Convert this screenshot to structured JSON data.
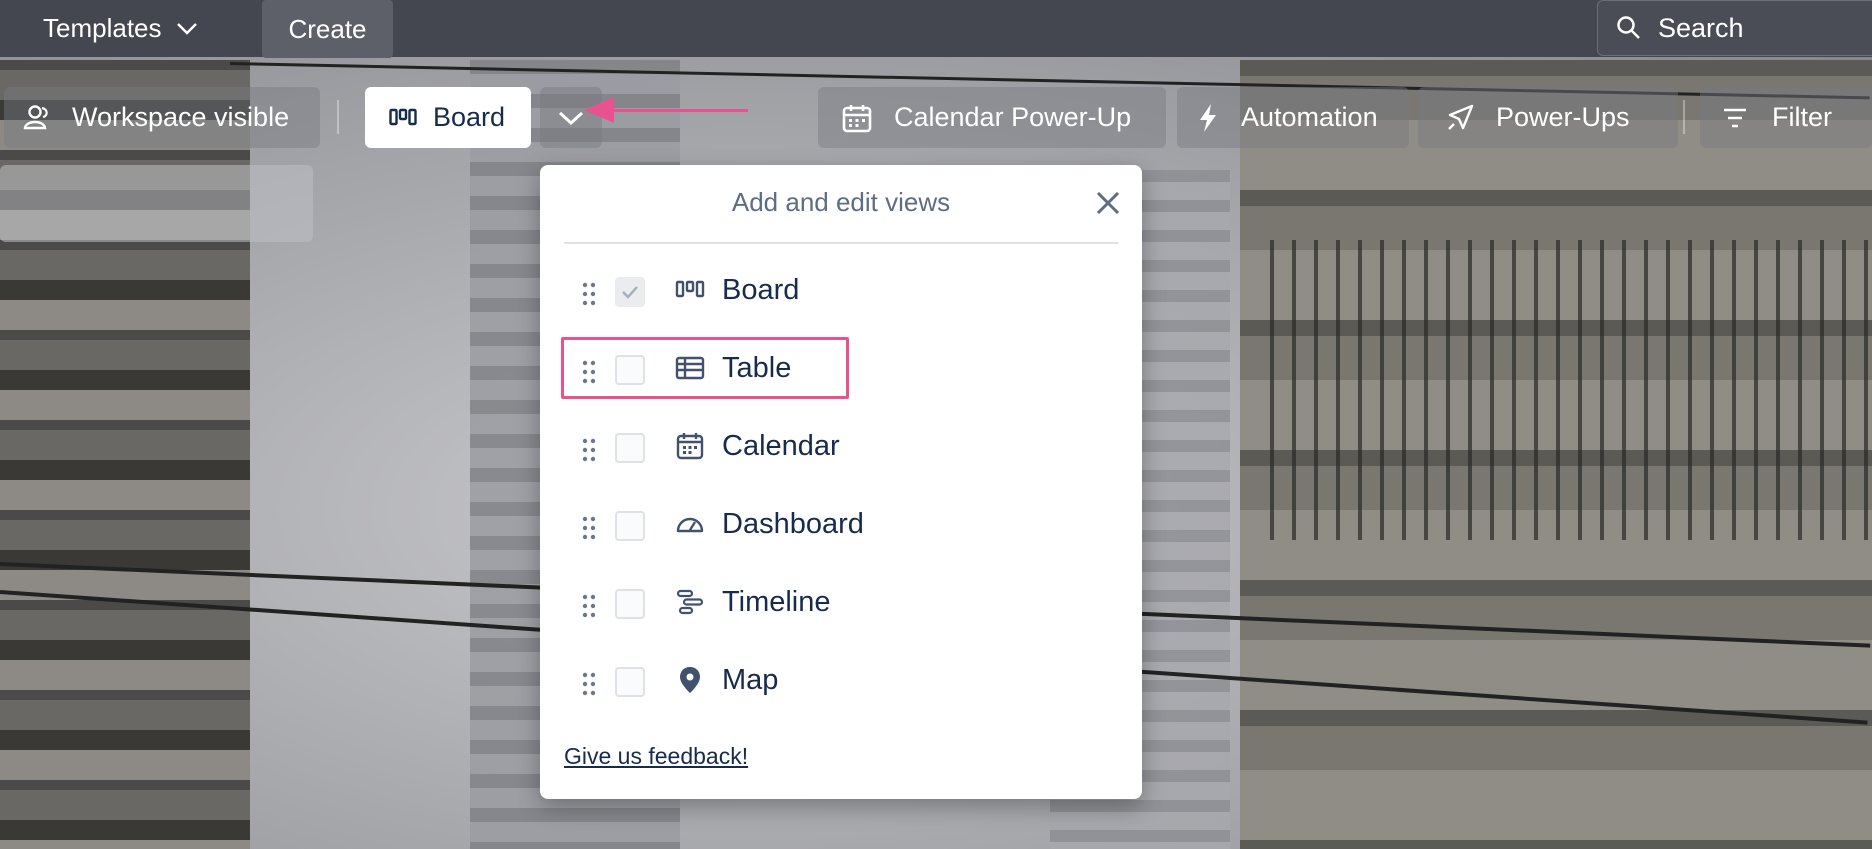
{
  "topbar": {
    "templates_label": "Templates",
    "create_label": "Create",
    "search_placeholder": "Search"
  },
  "board_header": {
    "visibility_label": "Workspace visible",
    "board_tab_label": "Board",
    "calendar_label": "Calendar Power-Up",
    "automation_label": "Automation",
    "powerups_label": "Power-Ups",
    "filter_label": "Filter"
  },
  "views_popover": {
    "title": "Add and edit views",
    "items": [
      {
        "label": "Board",
        "icon": "board-icon",
        "checked": true
      },
      {
        "label": "Table",
        "icon": "table-icon",
        "checked": false
      },
      {
        "label": "Calendar",
        "icon": "calendar-icon",
        "checked": false
      },
      {
        "label": "Dashboard",
        "icon": "dashboard-icon",
        "checked": false
      },
      {
        "label": "Timeline",
        "icon": "timeline-icon",
        "checked": false
      },
      {
        "label": "Map",
        "icon": "map-pin-icon",
        "checked": false
      }
    ],
    "feedback_link": "Give us feedback!"
  },
  "colors": {
    "annotation": "#e8538f",
    "text_dark": "#172b4d",
    "header_bg": "#44474f"
  }
}
